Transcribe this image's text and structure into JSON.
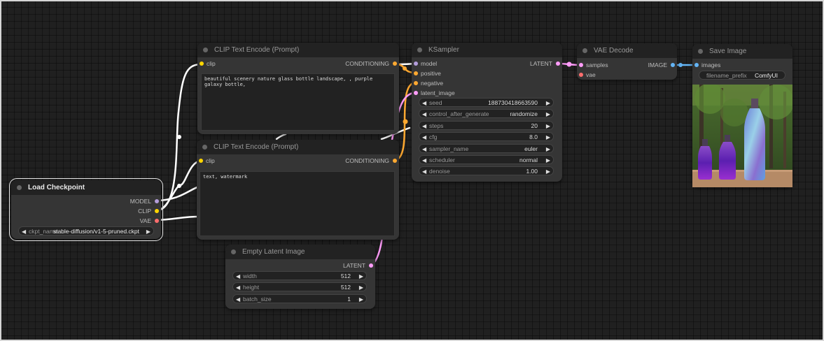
{
  "colors": {
    "clip": "#ffd500",
    "model": "#b39ddb",
    "vae": "#ff6e6e",
    "conditioning": "#ffa931",
    "latent": "#ff9cf9",
    "image": "#64b5f6",
    "link_white": "#ffffff"
  },
  "load_checkpoint": {
    "title": "Load Checkpoint",
    "outputs": {
      "model": "MODEL",
      "clip": "CLIP",
      "vae": "VAE"
    },
    "ckpt_name_label": "ckpt_name",
    "ckpt_name_value": "stable-diffusion/v1-5-pruned.ckpt"
  },
  "clip_pos": {
    "title": "CLIP Text Encode (Prompt)",
    "input_clip": "clip",
    "output": "CONDITIONING",
    "text": "beautiful scenery nature glass bottle landscape, , purple galaxy bottle,"
  },
  "clip_neg": {
    "title": "CLIP Text Encode (Prompt)",
    "input_clip": "clip",
    "output": "CONDITIONING",
    "text": "text, watermark"
  },
  "empty_latent": {
    "title": "Empty Latent Image",
    "output": "LATENT",
    "width_label": "width",
    "width_value": "512",
    "height_label": "height",
    "height_value": "512",
    "batch_label": "batch_size",
    "batch_value": "1"
  },
  "ksampler": {
    "title": "KSampler",
    "inputs": {
      "model": "model",
      "positive": "positive",
      "negative": "negative",
      "latent": "latent_image"
    },
    "output": "LATENT",
    "widgets": {
      "seed_label": "seed",
      "seed_value": "188730418663590",
      "cag_label": "control_after_generate",
      "cag_value": "randomize",
      "steps_label": "steps",
      "steps_value": "20",
      "cfg_label": "cfg",
      "cfg_value": "8.0",
      "sampler_label": "sampler_name",
      "sampler_value": "euler",
      "scheduler_label": "scheduler",
      "scheduler_value": "normal",
      "denoise_label": "denoise",
      "denoise_value": "1.00"
    }
  },
  "vae_decode": {
    "title": "VAE Decode",
    "inputs": {
      "samples": "samples",
      "vae": "vae"
    },
    "output": "IMAGE"
  },
  "save_image": {
    "title": "Save Image",
    "input_images": "images",
    "prefix_label": "filename_prefix",
    "prefix_value": "ComfyUI"
  }
}
